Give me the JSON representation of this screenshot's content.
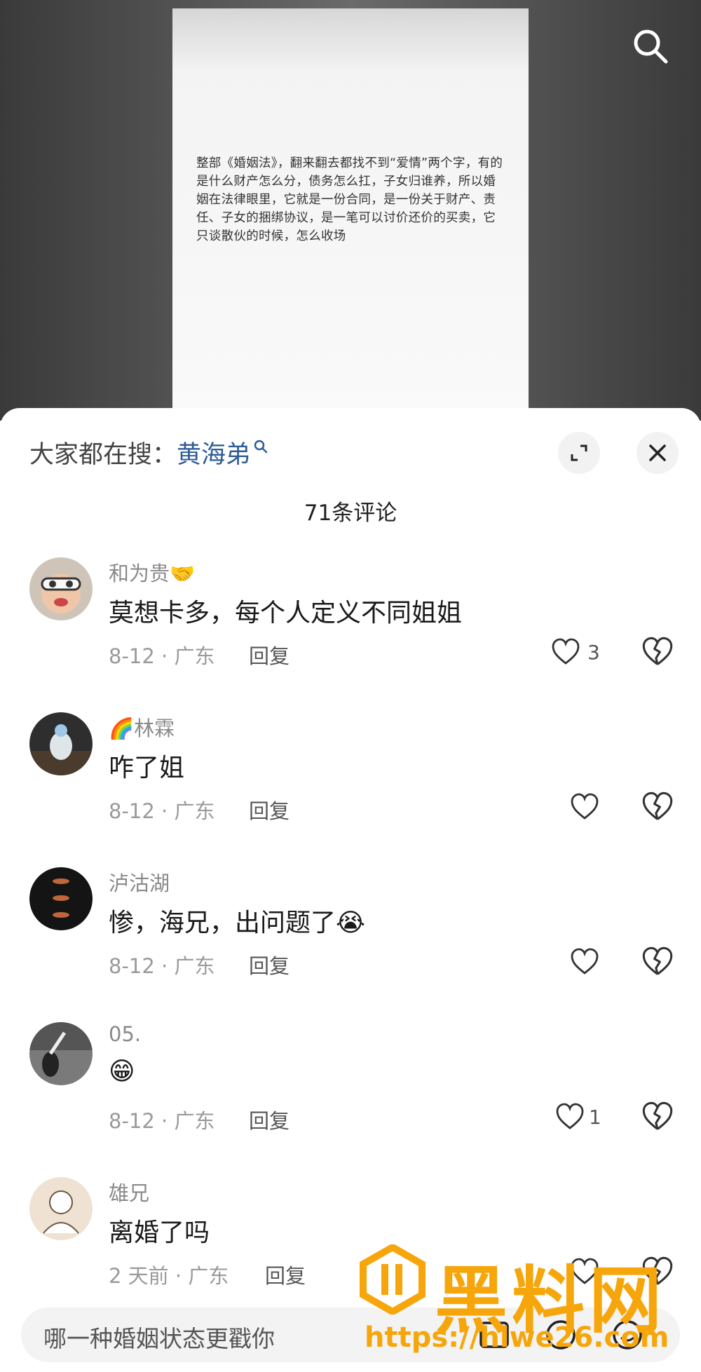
{
  "video": {
    "doc_text": "整部《婚姻法》，翻来翻去都找不到“爱情”两个字，有的是什么财产怎么分，债务怎么扛，子女归谁养，所以婚姻在法律眼里，它就是一份合同，是一份关于财产、责任、子女的捆绑协议，是一笔可以讨价还价的买卖，它只谈散伙的时候，怎么收场"
  },
  "header": {
    "hot_search_prefix": "大家都在搜：",
    "hot_search_term": "黄海弟",
    "comment_count": "71条评论"
  },
  "comments": [
    {
      "author": "和为贵🤝",
      "text": "莫想卡多，每个人定义不同姐姐",
      "date": "8-12 · 广东",
      "reply": "回复",
      "likes": "3"
    },
    {
      "author": "🌈林霖",
      "text": "咋了姐",
      "date": "8-12 · 广东",
      "reply": "回复",
      "likes": ""
    },
    {
      "author": "泸沽湖",
      "text": "惨，海兄，出问题了😭",
      "date": "8-12 · 广东",
      "reply": "回复",
      "likes": ""
    },
    {
      "author": "05.",
      "text": "😁",
      "date": "8-12 · 广东",
      "reply": "回复",
      "likes": "1"
    },
    {
      "author": "雄兄",
      "text": "离婚了吗",
      "date": "2 天前 · 广东",
      "reply": "回复",
      "likes": ""
    }
  ],
  "input": {
    "placeholder": "哪一种婚姻状态更戳你"
  },
  "watermark": {
    "text": "黑料网",
    "url": "https://hlwe26.com"
  },
  "colors": {
    "hot_term": "#2d5c99",
    "watermark": "#f6a60a",
    "muted": "#9a9a9a"
  }
}
